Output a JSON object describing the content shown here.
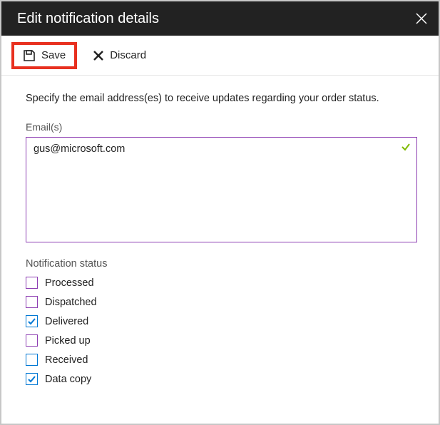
{
  "header": {
    "title": "Edit notification details"
  },
  "toolbar": {
    "save_label": "Save",
    "discard_label": "Discard"
  },
  "content": {
    "description": "Specify the email address(es) to receive updates regarding your order status.",
    "emails_label": "Email(s)",
    "emails_value": "gus@microsoft.com",
    "status_heading": "Notification status",
    "statuses": [
      {
        "label": "Processed",
        "checked": false,
        "style": "purple"
      },
      {
        "label": "Dispatched",
        "checked": false,
        "style": "purple"
      },
      {
        "label": "Delivered",
        "checked": true,
        "style": "blue"
      },
      {
        "label": "Picked up",
        "checked": false,
        "style": "purple"
      },
      {
        "label": "Received",
        "checked": false,
        "style": "blue"
      },
      {
        "label": "Data copy",
        "checked": true,
        "style": "blue"
      }
    ]
  },
  "colors": {
    "accent_purple": "#8e3fb3",
    "accent_blue": "#0078d4",
    "valid_green": "#7fba00",
    "highlight_red": "#e8301f"
  }
}
